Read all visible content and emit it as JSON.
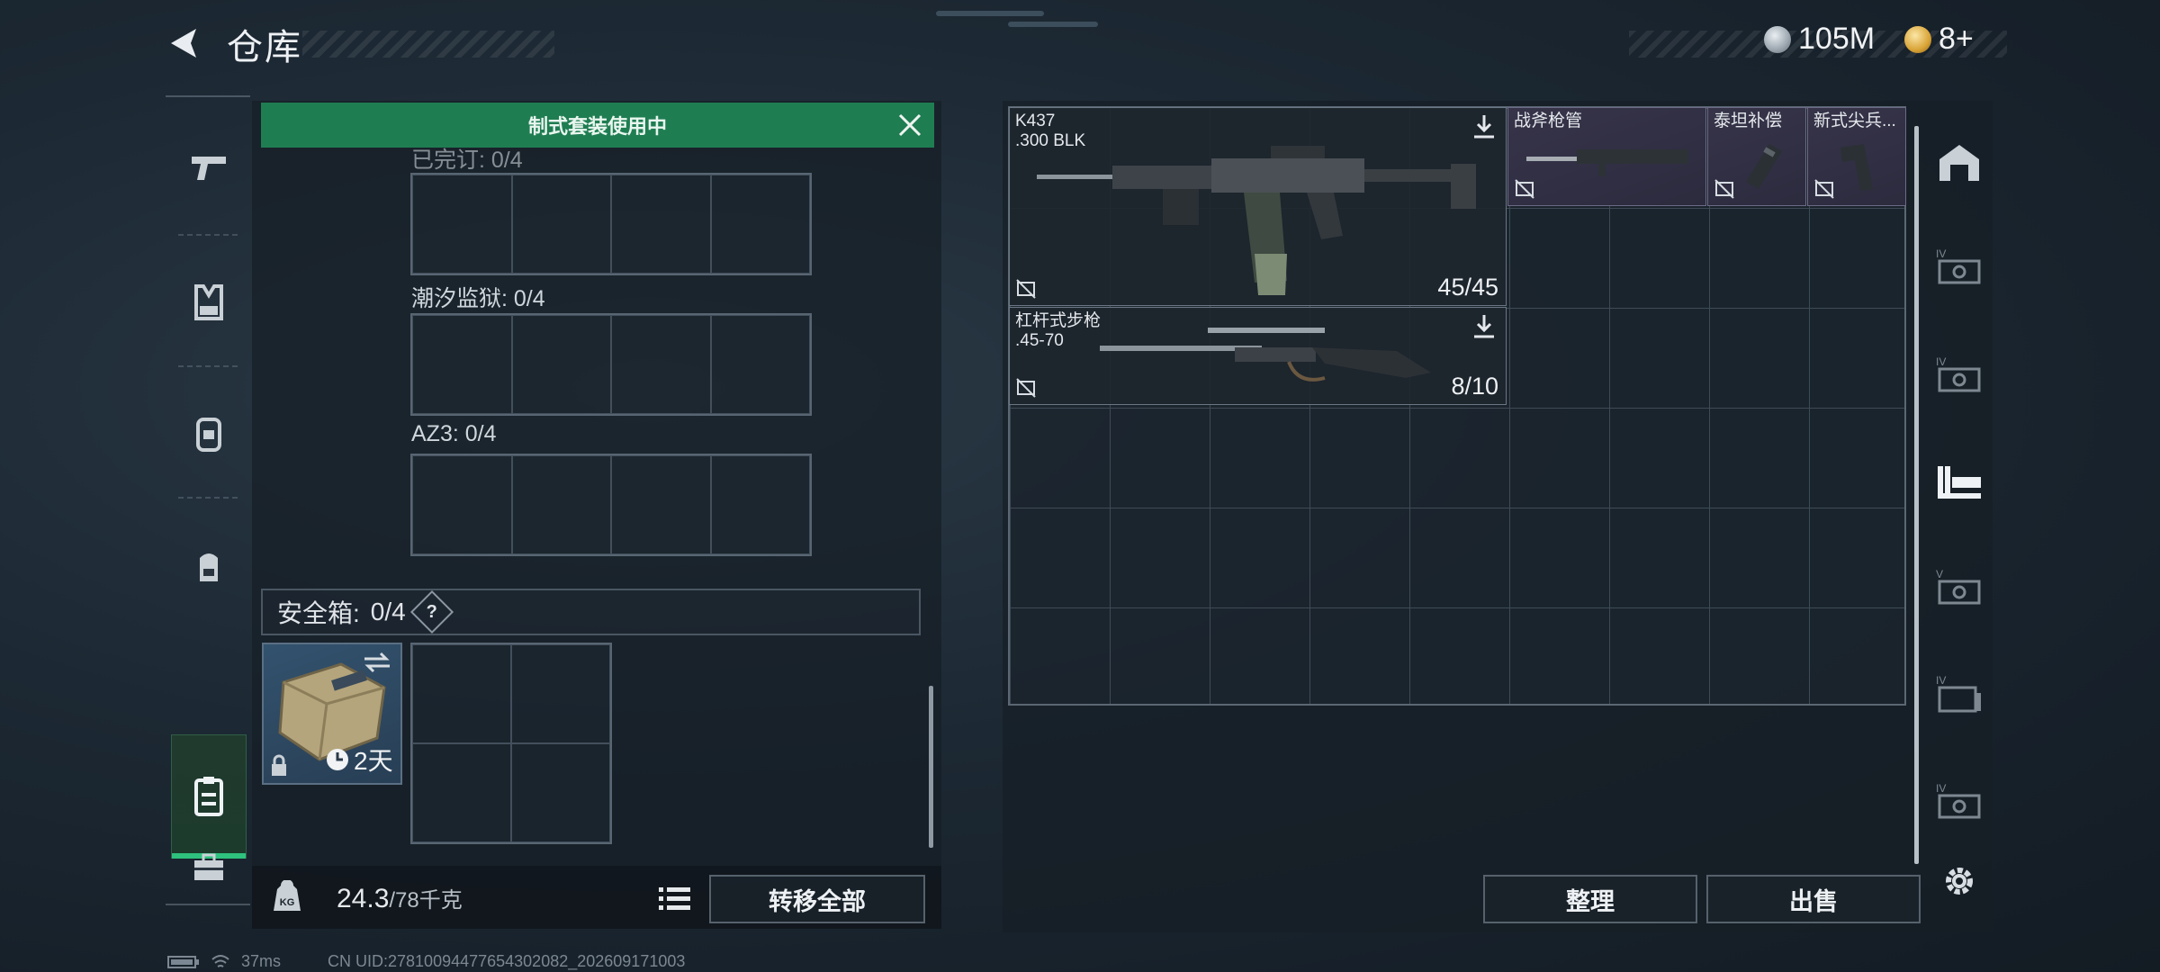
{
  "header": {
    "title": "仓库",
    "currency": [
      {
        "icon": "silver-coin-icon",
        "value": "105M"
      },
      {
        "icon": "gold-coin-icon",
        "value": "8+"
      }
    ]
  },
  "kit_banner": {
    "text": "制式套装使用中"
  },
  "containers": [
    {
      "label": "已完订: 0/4"
    },
    {
      "label": "潮汐监狱: 0/4"
    },
    {
      "label": "AZ3: 0/4"
    }
  ],
  "safe_box": {
    "label": "安全箱:",
    "count": "0/4",
    "help": "?",
    "timer": "2天"
  },
  "weight": {
    "current": "24.3",
    "max": "/78千克"
  },
  "buttons": {
    "transfer_all": "转移全部",
    "organize": "整理",
    "sell": "出售"
  },
  "items": [
    {
      "name": "K437\n.300 BLK",
      "count": "45/45"
    },
    {
      "name": "杠杆式步枪\n.45-70",
      "count": "8/10"
    },
    {
      "name": "战斧枪管",
      "count": ""
    },
    {
      "name": "泰坦补偿",
      "count": ""
    },
    {
      "name": "新式尖兵...",
      "count": ""
    }
  ],
  "status_bar": {
    "ping": "37ms",
    "uid": "CN UID:278100944776543020​82_202609171003"
  },
  "colors": {
    "banner": "#1f7d52",
    "accent_green": "#2ec27e",
    "purple_item": "#37344a"
  }
}
